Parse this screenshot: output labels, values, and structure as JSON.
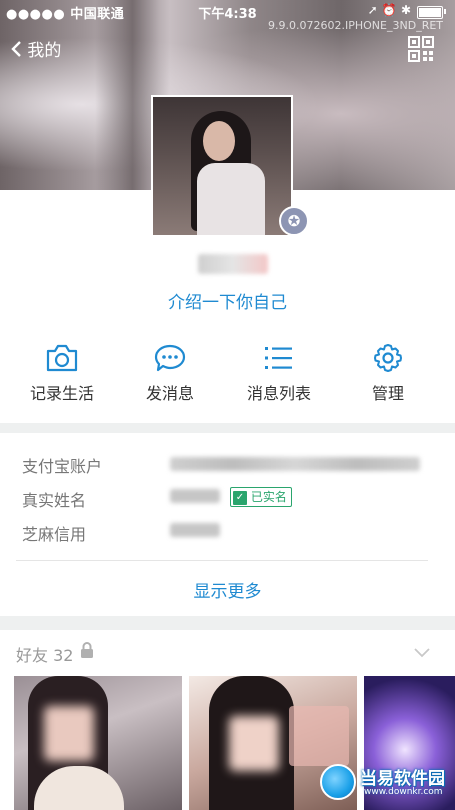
{
  "status_bar": {
    "carrier": "●●●●● 中国联通",
    "time": "下午4:38",
    "icons": "➚ ⏰ ✱"
  },
  "watermark": "9.9.0.072602.IPHONE_3ND_RET",
  "nav": {
    "back_label": "我的",
    "back_icon": "chevron-left-icon",
    "qr_icon": "qrcode-icon"
  },
  "profile": {
    "intro_link": "介绍一下你自己",
    "badge_icon": "star-badge-icon",
    "badge_color": "#8d95b3"
  },
  "actions": [
    {
      "label": "记录生活",
      "icon": "camera-icon"
    },
    {
      "label": "发消息",
      "icon": "chat-bubble-icon"
    },
    {
      "label": "消息列表",
      "icon": "list-icon"
    },
    {
      "label": "管理",
      "icon": "gear-icon"
    }
  ],
  "account": {
    "alipay_label": "支付宝账户",
    "realname_label": "真实姓名",
    "verified_badge": "已实名",
    "credit_label": "芝麻信用",
    "show_more": "显示更多"
  },
  "friends": {
    "title": "好友 32",
    "lock_icon": "lock-icon",
    "expand_icon": "chevron-down-icon"
  },
  "logo": {
    "name": "当易软件园",
    "url_text": "www.downkr.com"
  },
  "colors": {
    "link": "#1f8ad1",
    "verified": "#2aa56d",
    "background": "#eef0f0"
  }
}
